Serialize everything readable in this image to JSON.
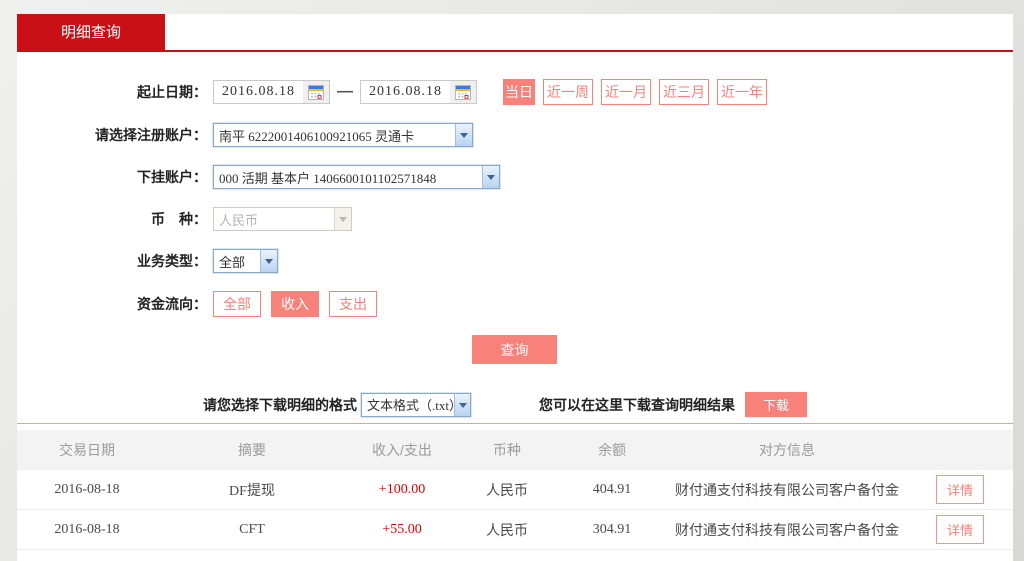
{
  "tab": {
    "label": "明细查询"
  },
  "form": {
    "date_range": {
      "label": "起止日期：",
      "start": "2016.08.18",
      "end": "2016.08.18",
      "separator": "—",
      "quick_buttons": [
        {
          "label": "当日",
          "active": true
        },
        {
          "label": "近一周",
          "active": false
        },
        {
          "label": "近一月",
          "active": false
        },
        {
          "label": "近三月",
          "active": false
        },
        {
          "label": "近一年",
          "active": false
        }
      ]
    },
    "registered_account": {
      "label": "请选择注册账户：",
      "value": "南平 6222001406100921065 灵通卡"
    },
    "sub_account": {
      "label": "下挂账户：",
      "value": "000 活期 基本户 1406600101102571848"
    },
    "currency": {
      "label": "币　种：",
      "value": "人民币",
      "disabled": true
    },
    "business_type": {
      "label": "业务类型：",
      "value": "全部"
    },
    "fund_flow": {
      "label": "资金流向：",
      "options": [
        {
          "label": "全部",
          "active": false
        },
        {
          "label": "收入",
          "active": true
        },
        {
          "label": "支出",
          "active": false
        }
      ]
    },
    "query_button_label": "查询"
  },
  "download": {
    "format_label": "请您选择下载明细的格式",
    "format_value": "文本格式（.txt）",
    "hint": "您可以在这里下载查询明细结果",
    "button_label": "下载"
  },
  "table": {
    "headers": [
      "交易日期",
      "摘要",
      "收入/支出",
      "币种",
      "余额",
      "对方信息"
    ],
    "rows": [
      {
        "date": "2016-08-18",
        "summary": "DF提现",
        "amount": "+100.00",
        "currency": "人民币",
        "balance": "404.91",
        "counterparty": "财付通支付科技有限公司客户备付金",
        "detail_label": "详情"
      },
      {
        "date": "2016-08-18",
        "summary": "CFT",
        "amount": "+55.00",
        "currency": "人民币",
        "balance": "304.91",
        "counterparty": "财付通支付科技有限公司客户备付金",
        "detail_label": "详情"
      }
    ]
  },
  "colors": {
    "brand_red": "#c81016",
    "accent_salmon": "#f8817a",
    "amount_red": "#e60000",
    "divider_pink": "#ee9d98"
  }
}
